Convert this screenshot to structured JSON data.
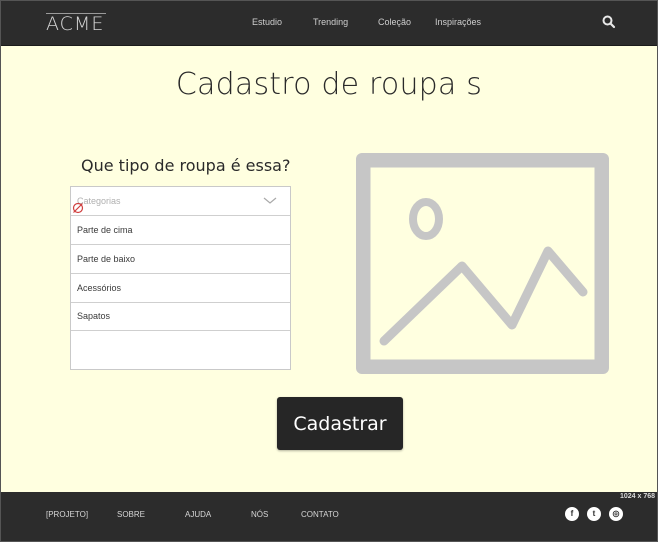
{
  "header": {
    "logo": "ACME",
    "nav": [
      "Estudio",
      "Trending",
      "Coleção",
      "Inspirações"
    ],
    "search_icon": "search-icon"
  },
  "main": {
    "title": "Cadastro de roupa s",
    "question": "Que tipo de roupa é essa?",
    "dropdown": {
      "placeholder": "Categorias",
      "options": [
        "Parte de cima",
        "Parte de baixo",
        "Acessórios",
        "Sapatos"
      ]
    },
    "image_placeholder_icon": "image-placeholder-icon",
    "submit_label": "Cadastrar"
  },
  "size_note": "1024 x 768",
  "footer": {
    "links": [
      "[PROJETO]",
      "SOBRE",
      "AJUDA",
      "NÓS",
      "CONTATO"
    ],
    "social": [
      {
        "icon": "facebook-icon",
        "glyph": "f"
      },
      {
        "icon": "twitter-icon",
        "glyph": "t"
      },
      {
        "icon": "dribbble-icon",
        "glyph": "◎"
      }
    ]
  },
  "colors": {
    "background": "#ffffe0",
    "bar": "#2c2c2c",
    "button": "#262626",
    "placeholder_gray": "#c6c6c6"
  }
}
